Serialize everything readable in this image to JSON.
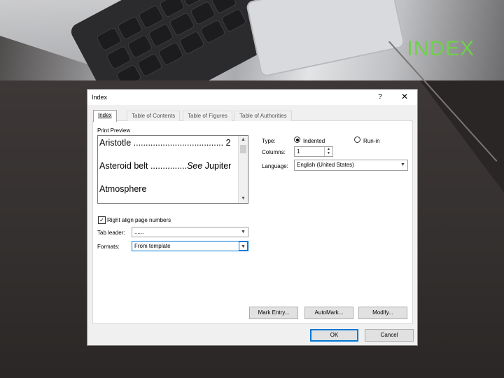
{
  "slide": {
    "title": "INDEX",
    "title_color": "#6fd04b"
  },
  "dialog": {
    "title": "Index",
    "help_glyph": "?",
    "close_glyph": "✕",
    "tabs": [
      {
        "label": "Index",
        "active": true
      },
      {
        "label": "Table of Contents",
        "active": false
      },
      {
        "label": "Table of Figures",
        "active": false
      },
      {
        "label": "Table of Authorities",
        "active": false
      }
    ],
    "print_preview": {
      "label": "Print Preview",
      "entries": [
        {
          "text": "Aristotle ..................................... 2"
        },
        {
          "text_before": "Asteroid belt ...............",
          "italic": "See",
          "text_after": " Jupiter"
        },
        {
          "text": "Atmosphere"
        }
      ]
    },
    "right_align": {
      "label": "Right align page numbers",
      "checked": true
    },
    "tab_leader": {
      "label": "Tab leader:",
      "value": "......"
    },
    "formats": {
      "label": "Formats:",
      "value": "From template"
    },
    "type": {
      "label": "Type:",
      "options": [
        {
          "label": "Indented",
          "selected": true
        },
        {
          "label": "Run-in",
          "selected": false
        }
      ]
    },
    "columns": {
      "label": "Columns:",
      "value": "1"
    },
    "language": {
      "label": "Language:",
      "value": "English (United States)"
    },
    "buttons": {
      "mark_entry": "Mark Entry...",
      "automark": "AutoMark...",
      "modify": "Modify...",
      "ok": "OK",
      "cancel": "Cancel"
    }
  }
}
